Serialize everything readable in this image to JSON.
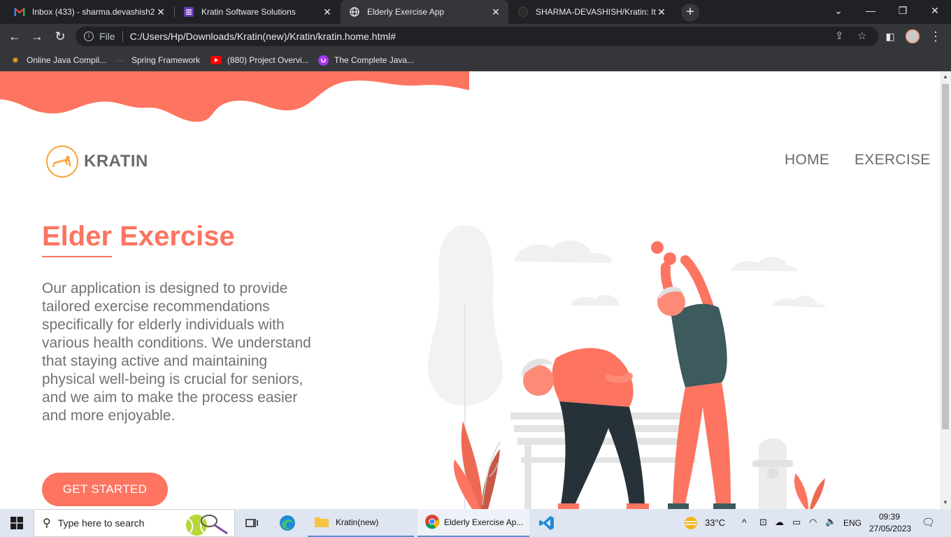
{
  "browser": {
    "tabs": [
      {
        "title": "Inbox (433) - sharma.devashish2",
        "favicon": "gmail-icon"
      },
      {
        "title": "Kratin Software Solutions",
        "favicon": "forms-icon"
      },
      {
        "title": "Elderly Exercise App",
        "favicon": "globe-icon"
      },
      {
        "title": "SHARMA-DEVASHISH/Kratin: It is",
        "favicon": "github-icon"
      }
    ],
    "address": {
      "scheme": "File",
      "url": "C:/Users/Hp/Downloads/Kratin(new)/Kratin/kratin.home.html#"
    },
    "bookmarks": [
      {
        "label": "Online Java Compil...",
        "icon": "compiler-icon"
      },
      {
        "label": "Spring Framework",
        "icon": "spring-icon"
      },
      {
        "label": "(880) Project Overvi...",
        "icon": "youtube-icon"
      },
      {
        "label": "The Complete Java...",
        "icon": "udemy-icon"
      }
    ]
  },
  "page": {
    "brand": "KRATIN",
    "nav": [
      "HOME",
      "EXERCISE"
    ],
    "hero": {
      "title": "Elder Exercise",
      "description": "Our application is designed to provide tailored exercise recommendations specifically for elderly individuals with various health conditions. We understand that staying active and maintaining physical well-being is crucial for seniors, and we aim to make the process easier and more enjoyable.",
      "cta": "GET STARTED"
    },
    "colors": {
      "accent": "#fd7461",
      "logo_ring": "#f7a53a",
      "text": "#727272"
    }
  },
  "taskbar": {
    "search_placeholder": "Type here to search",
    "apps": [
      {
        "label": "Kratin(new)",
        "icon": "folder-icon"
      },
      {
        "label": "Elderly Exercise Ap...",
        "icon": "chrome-icon"
      }
    ],
    "weather": "33°C",
    "language": "ENG",
    "time": "09:39",
    "date": "27/05/2023"
  }
}
